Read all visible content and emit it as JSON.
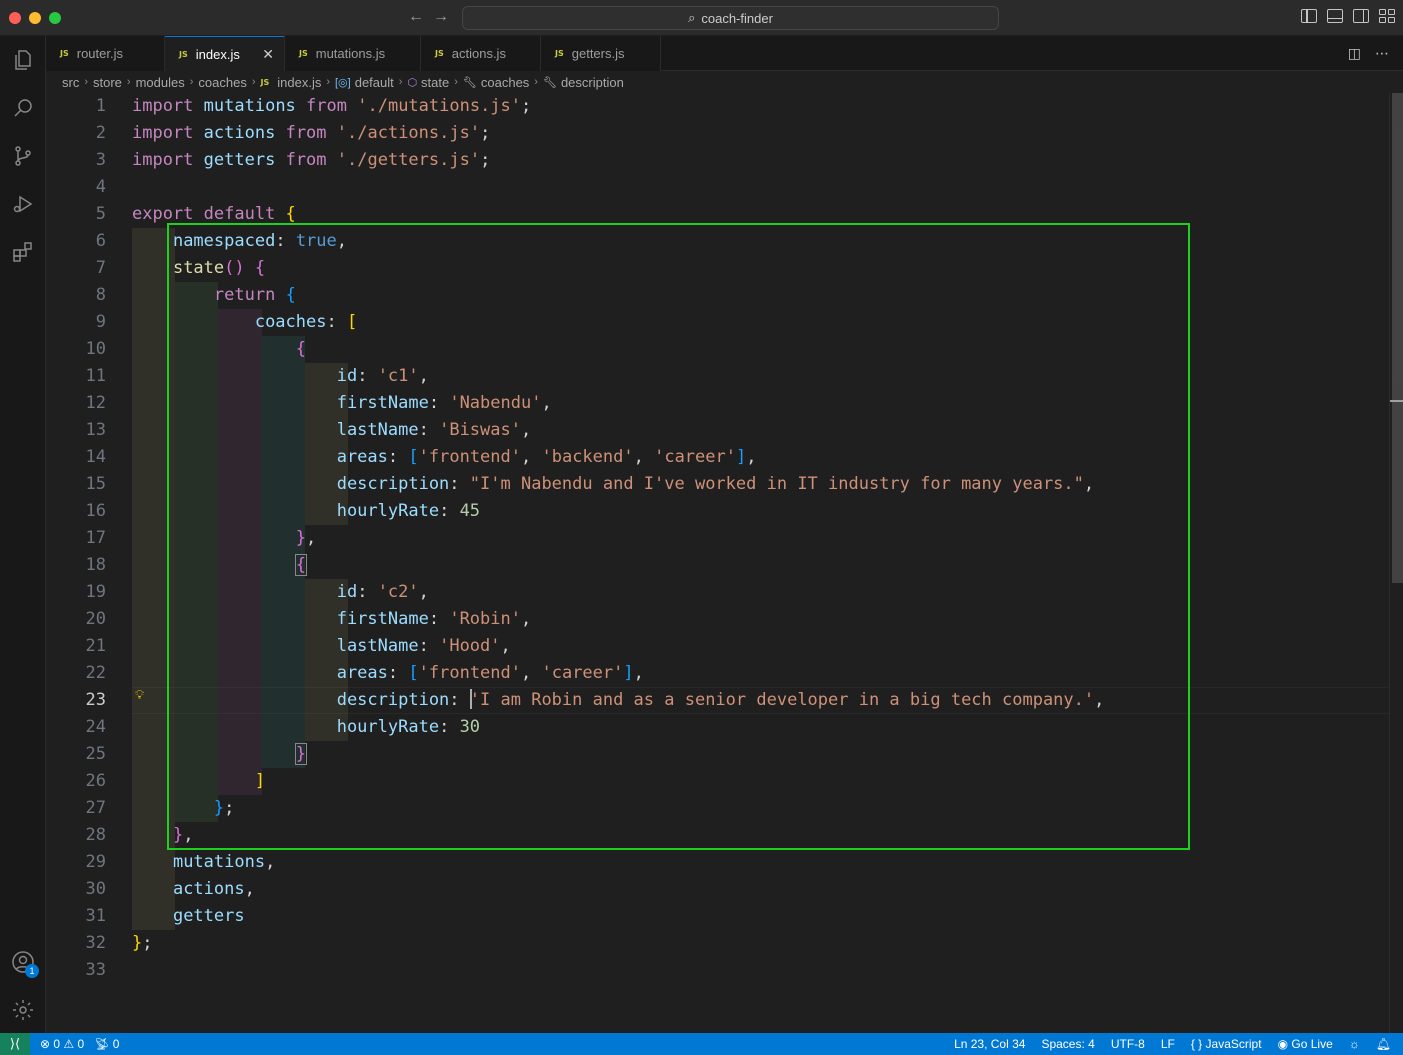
{
  "window": {
    "search_label": "coach-finder"
  },
  "tabs": [
    {
      "label": "router.js",
      "icon": "JS"
    },
    {
      "label": "index.js",
      "icon": "JS",
      "active": true
    },
    {
      "label": "mutations.js",
      "icon": "JS"
    },
    {
      "label": "actions.js",
      "icon": "JS"
    },
    {
      "label": "getters.js",
      "icon": "JS"
    }
  ],
  "breadcrumb": [
    "src",
    "store",
    "modules",
    "coaches",
    "index.js",
    "default",
    "state",
    "coaches",
    "description"
  ],
  "editor": {
    "current_line": 23,
    "line_numbers": [
      "1",
      "2",
      "3",
      "4",
      "5",
      "6",
      "7",
      "8",
      "9",
      "10",
      "11",
      "12",
      "13",
      "14",
      "15",
      "16",
      "17",
      "18",
      "19",
      "20",
      "21",
      "22",
      "23",
      "24",
      "25",
      "26",
      "27",
      "28",
      "29",
      "30",
      "31",
      "32",
      "33"
    ],
    "imports": [
      {
        "name": "mutations",
        "path": "'./mutations.js'"
      },
      {
        "name": "actions",
        "path": "'./actions.js'"
      },
      {
        "name": "getters",
        "path": "'./getters.js'"
      }
    ],
    "coaches": [
      {
        "id": "'c1'",
        "firstName": "'Nabendu'",
        "lastName": "'Biswas'",
        "areas": [
          "'frontend'",
          "'backend'",
          "'career'"
        ],
        "description": "\"I'm Nabendu and I've worked in IT industry for many years.\"",
        "hourlyRate": "45"
      },
      {
        "id": "'c2'",
        "firstName": "'Robin'",
        "lastName": "'Hood'",
        "areas": [
          "'frontend'",
          "'career'"
        ],
        "description": "'I am Robin and as a senior developer in a big tech company.'",
        "hourlyRate": "30"
      }
    ]
  },
  "status": {
    "errors": "0",
    "warnings": "0",
    "ports": "0",
    "position": "Ln 23, Col 34",
    "spaces": "Spaces: 4",
    "encoding": "UTF-8",
    "eol": "LF",
    "language": "JavaScript",
    "golive": "Go Live"
  },
  "activity_badge": "1",
  "colors": {
    "accent": "#0078d4",
    "highlight_box": "#1fd11f",
    "remote": "#16825d"
  }
}
